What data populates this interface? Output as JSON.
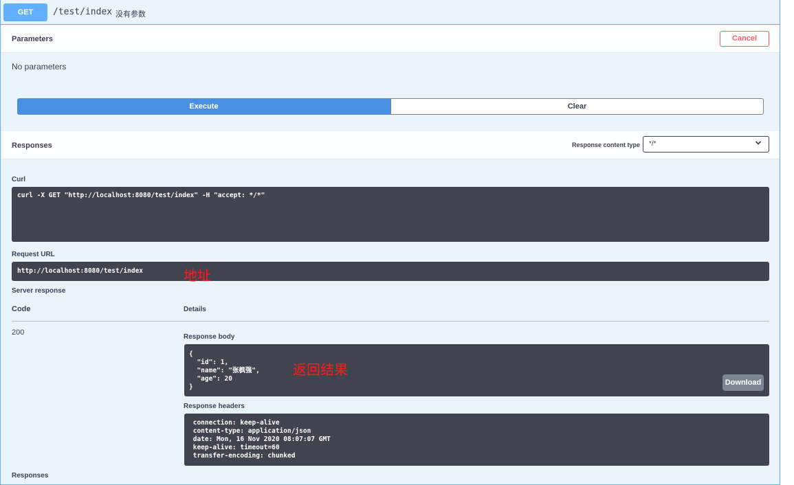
{
  "summary": {
    "method": "GET",
    "path": "/test/index",
    "description": "没有参数"
  },
  "parameters": {
    "title": "Parameters",
    "cancel_label": "Cancel",
    "empty_text": "No parameters"
  },
  "actions": {
    "execute_label": "Execute",
    "clear_label": "Clear"
  },
  "responses_header": {
    "title": "Responses",
    "content_type_label": "Response content type",
    "content_type_value": "*/*"
  },
  "curl": {
    "label": "Curl",
    "command": "curl -X GET \"http://localhost:8080/test/index\" -H \"accept: */*\""
  },
  "request_url": {
    "label": "Request URL",
    "value": "http://localhost:8080/test/index",
    "annotation": "地址"
  },
  "server_response": {
    "label": "Server response",
    "code_header": "Code",
    "details_header": "Details",
    "code": "200",
    "body_label": "Response body",
    "body": "{\n  \"id\": 1,\n  \"name\": \"张枫强\",\n  \"age\": 20\n}",
    "body_annotation": "返回结果",
    "download_label": "Download",
    "headers_label": "Response headers",
    "headers": " connection: keep-alive\n content-type: application/json\n date: Mon, 16 Nov 2020 08:07:07 GMT\n keep-alive: timeout=60\n transfer-encoding: chunked"
  },
  "footer_responses_label": "Responses",
  "colors": {
    "accent": "#61affe",
    "execute": "#4990e2",
    "cancel": "#ff6060",
    "code_bg": "#41444e",
    "annotation": "#ff1a1a"
  },
  "icons": {
    "select_arrow": "chevron-down-icon"
  }
}
